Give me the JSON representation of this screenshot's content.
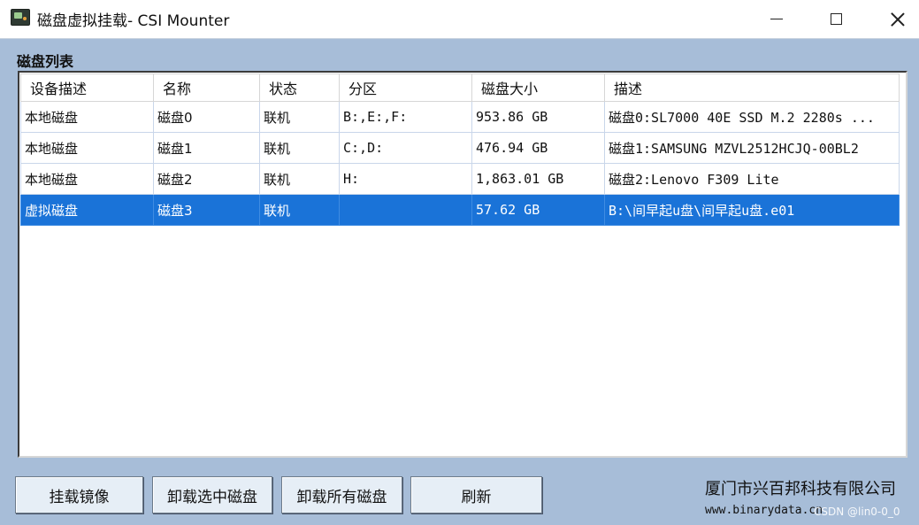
{
  "window": {
    "title": "磁盘虚拟挂载- CSI Mounter"
  },
  "list": {
    "title": "磁盘列表",
    "columns": [
      "设备描述",
      "名称",
      "状态",
      "分区",
      "磁盘大小",
      "描述"
    ],
    "rows": [
      {
        "type": "本地磁盘",
        "name": "磁盘0",
        "status": "联机",
        "partitions": "B:,E:,F:",
        "size": "953.86 GB",
        "desc": "磁盘0:SL7000 40E SSD  M.2 2280s ...",
        "selected": false
      },
      {
        "type": "本地磁盘",
        "name": "磁盘1",
        "status": "联机",
        "partitions": "C:,D:",
        "size": "476.94 GB",
        "desc": "磁盘1:SAMSUNG MZVL2512HCJQ-00BL2",
        "selected": false
      },
      {
        "type": "本地磁盘",
        "name": "磁盘2",
        "status": "联机",
        "partitions": "H:",
        "size": "1,863.01 GB",
        "desc": "磁盘2:Lenovo F309 Lite",
        "selected": false
      },
      {
        "type": "虚拟磁盘",
        "name": "磁盘3",
        "status": "联机",
        "partitions": "",
        "size": "57.62 GB",
        "desc": "B:\\间早起u盘\\间早起u盘.e01",
        "selected": true
      }
    ]
  },
  "buttons": {
    "mount_image": "挂载镜像",
    "unmount_selected": "卸载选中磁盘",
    "unmount_all": "卸载所有磁盘",
    "refresh": "刷新"
  },
  "footer": {
    "company": "厦门市兴百邦科技有限公司",
    "website": "www.binarydata.cn",
    "watermark": "CSDN @lin0-0_0"
  },
  "colors": {
    "background": "#a7bdd8",
    "selection": "#1a73d8"
  }
}
